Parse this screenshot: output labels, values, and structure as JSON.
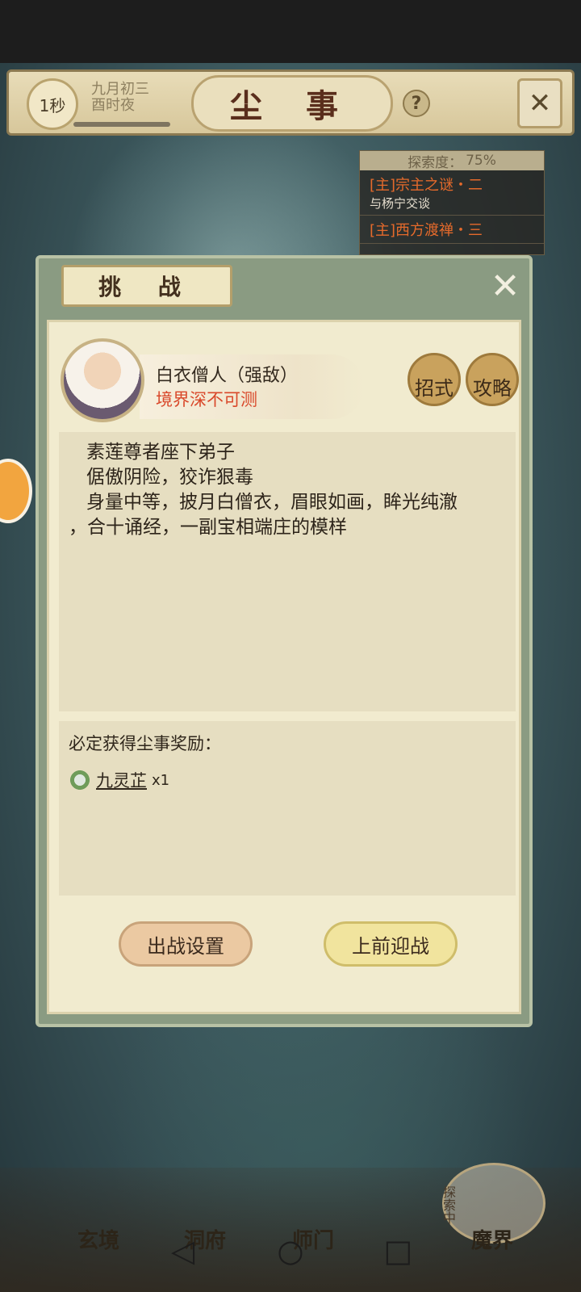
{
  "header": {
    "time_speed": "1秒",
    "date_line1": "九月初三",
    "date_line2": "酉时夜",
    "title": "尘 事",
    "help_glyph": "?",
    "expand_glyph": "✕"
  },
  "quest_panel": {
    "progress_label": "探索度：",
    "progress_value": "75%",
    "items": [
      {
        "title": "[主]宗主之谜・二",
        "subtitle": "与杨宁交谈"
      },
      {
        "title": "[主]西方渡禅・三",
        "subtitle": ""
      }
    ]
  },
  "dialog": {
    "tab_title": "挑 战",
    "enemy": {
      "name": "白衣僧人（强敌）",
      "realm": "境界深不可测"
    },
    "moves_label": "招式",
    "guide_label": "攻略",
    "description": [
      "素莲尊者座下弟子",
      "倨傲阴险，狡诈狠毒",
      "身量中等，披月白僧衣，眉眼如画，眸光纯澈",
      "，合十诵经，一副宝相端庄的模样"
    ],
    "reward_title": "必定获得尘事奖励：",
    "reward_item": {
      "name": "九灵芷",
      "qty": "x1",
      "icon": "herb-icon"
    },
    "settings_button": "出战设置",
    "fight_button": "上前迎战"
  },
  "bottom_nav": {
    "items": [
      "玄境",
      "洞府",
      "师门",
      "魔界"
    ],
    "explore_badge": "探索中"
  },
  "system_nav": [
    "back-icon",
    "home-icon",
    "recent-icon"
  ]
}
